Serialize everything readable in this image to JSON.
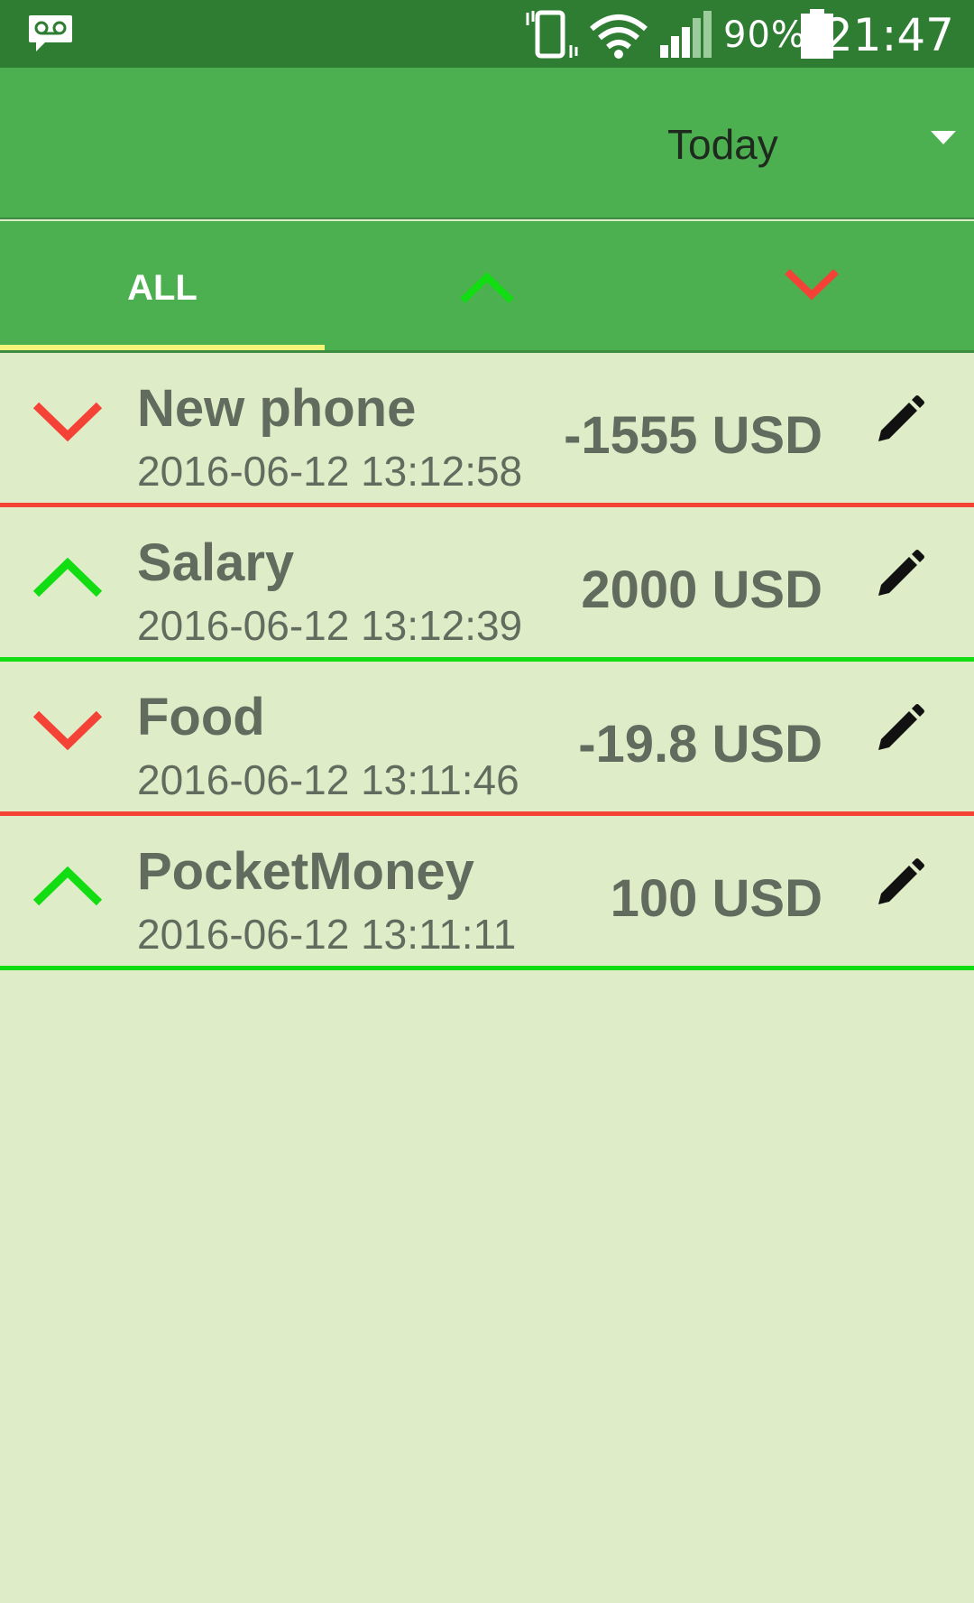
{
  "status_bar": {
    "battery_percent": "90%",
    "time": "21:47",
    "icons": [
      "voicemail-icon",
      "vibrate-icon",
      "wifi-icon",
      "signal-icon",
      "battery-icon"
    ]
  },
  "app_bar": {
    "period_selected": "Today"
  },
  "tabs": [
    {
      "label": "ALL",
      "selected": true
    },
    {
      "icon": "arrow-up-icon",
      "color": "#12dc12",
      "selected": false
    },
    {
      "icon": "arrow-down-icon",
      "color": "#f44336",
      "selected": false
    }
  ],
  "transactions": [
    {
      "title": "New phone",
      "timestamp": "2016-06-12 13:12:58",
      "amount": "-1555 USD",
      "type": "expense"
    },
    {
      "title": "Salary",
      "timestamp": "2016-06-12 13:12:39",
      "amount": "2000 USD",
      "type": "income"
    },
    {
      "title": "Food",
      "timestamp": "2016-06-12 13:11:46",
      "amount": "-19.8 USD",
      "type": "expense"
    },
    {
      "title": "PocketMoney",
      "timestamp": "2016-06-12 13:11:11",
      "amount": "100 USD",
      "type": "income"
    }
  ],
  "colors": {
    "status_bar": "#2e7d32",
    "app_bar": "#4caf50",
    "background": "#dfecc8",
    "income": "#12dc12",
    "expense": "#f44336",
    "tab_indicator": "#f6f57a"
  }
}
